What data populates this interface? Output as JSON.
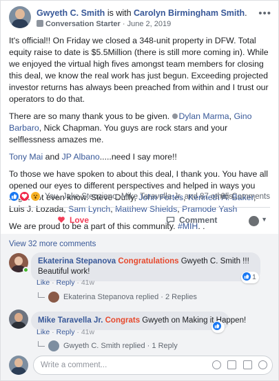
{
  "post": {
    "author": "Gwyeth C. Smith",
    "with_text": "is with",
    "with_name": "Carolyn Birmingham Smith",
    "with_suffix": ".",
    "role": "Conversation Starter",
    "date": "June 2, 2019",
    "date_sep": " · ",
    "p1": "It's official!! On Friday we closed a 348-unit property in DFW. Total equity raise to date is $5.5Million (there is still more coming in). While we enjoyed the virtual high fives amongst team members for closing this deal, we know the real work has just begun. Exceeding projected investor returns has always been preached from within and I trust our operators to do that.",
    "p2_a": "There are so many thank yous to be given.",
    "p2_tag1": "Dylan Marma",
    "p2_sep1": ",",
    "p2_tag2": "Gino Barbaro",
    "p2_sep2": ",",
    "p2_b": "Nick Chapman. You guys are rock stars and your selflessness amazes me.",
    "p3_tag1": "Tony Mai",
    "p3_and": "and",
    "p3_tag2": "JP Albano",
    "p3_b": ".....need I say more!!",
    "p4_a": "To those we have spoken to about this deal, I thank you. You have all opened our eyes to different perspectives and helped in ways you might not even know. Steve Duffy,",
    "p4_tag1": "John Fortes",
    "p4_sep1": ",",
    "p4_tag2": "Kenneth A. Baker",
    "p4_b": ", Luis J. Lozada,",
    "p4_tag3": "Sam Lynch",
    "p4_sep3": ",",
    "p4_tag4": "Matthew Shields",
    "p4_sep4": ",",
    "p4_tag5": "Pramode Yash",
    "p5_a": "We are proud to be a part of this community.",
    "p5_hashtag": "#MIH",
    "p5_b": ". ."
  },
  "reactions": {
    "names": "You, Jake Stenziano, Mike Taravella Jr. and 87 others",
    "comments_count": "65 Comments",
    "colors": {
      "like": "#1877f2",
      "love": "#f0284a",
      "wow": "#f7b125"
    }
  },
  "actions": {
    "love_label": "Love",
    "comment_label": "Comment"
  },
  "comments": {
    "view_more": "View 32 more comments",
    "items": [
      {
        "name": "Ekaterina Stepanova",
        "highlight": "Congratulations",
        "text_a": "Gwyeth C. Smith !!!",
        "text_b": "Beautiful work!",
        "like_label": "Like",
        "reply_label": "Reply",
        "sep": " · ",
        "time": "41w",
        "reaction_count": "1",
        "reply_name": "Ekaterina Stepanova replied",
        "reply_count": "2 Replies"
      },
      {
        "name": "Mike Taravella Jr.",
        "highlight": "Congrats",
        "text_a": "Gwyeth on Making it Happen!",
        "like_label": "Like",
        "reply_label": "Reply",
        "sep": " · ",
        "time": "41w",
        "reply_name": "Gwyeth C. Smith replied",
        "reply_count": "1 Reply"
      }
    ]
  },
  "composer": {
    "placeholder": "Write a comment..."
  }
}
